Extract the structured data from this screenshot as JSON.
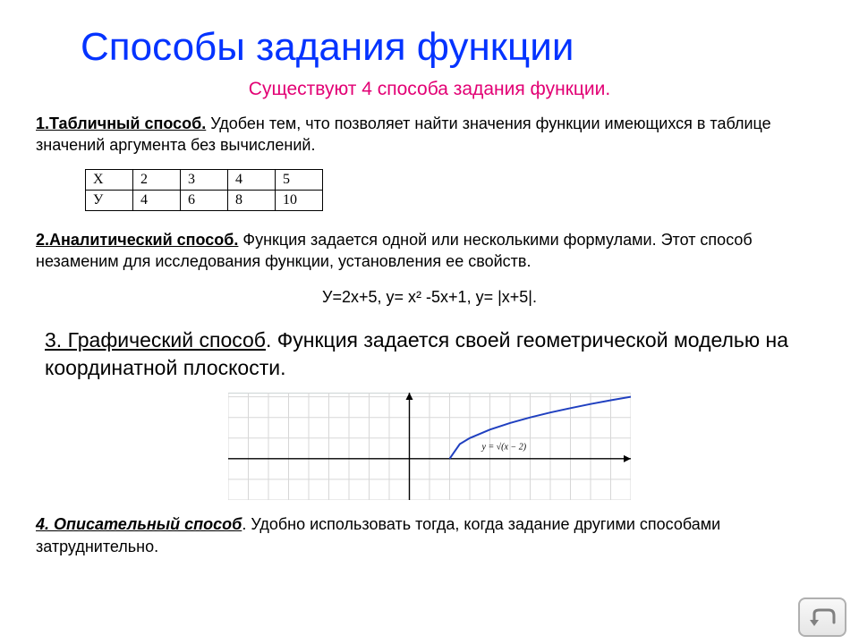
{
  "title": "Способы задания функции",
  "subtitle": "Существуют 4 способа задания функции.",
  "sections": {
    "s1": {
      "heading": "1.Табличный способ.",
      "text": " Удобен тем, что позволяет найти значения функции имеющихся в таблице значений аргумента без вычислений.",
      "table": {
        "row1": [
          "Х",
          "2",
          "3",
          "4",
          "5"
        ],
        "row2": [
          "У",
          "4",
          "6",
          "8",
          "10"
        ]
      }
    },
    "s2": {
      "heading": "2.Аналитический способ.",
      "text": " Функция задается одной или несколькими формулами. Этот способ незаменим для исследования функции, установления ее свойств.",
      "formulas": "У=2х+5,   у= х² -5х+1,    у= |х+5|."
    },
    "s3": {
      "heading": "3. Графический способ",
      "text": ". Функция задается своей геометрической моделью на координатной плоскости."
    },
    "s4": {
      "heading": " 4. Описательный способ",
      "text": ". Удобно использовать тогда, когда задание другими способами затруднительно."
    }
  },
  "chart_data": {
    "type": "line",
    "title": "",
    "function_label": "y = √(x − 2)",
    "xlabel": "",
    "ylabel": "",
    "xlim": [
      -9,
      11
    ],
    "ylim": [
      -2,
      3.2
    ],
    "grid": true,
    "series": [
      {
        "name": "y = √(x − 2)",
        "x": [
          2,
          2.5,
          3,
          4,
          5,
          6,
          7,
          8,
          9,
          10,
          11
        ],
        "y": [
          0,
          0.71,
          1,
          1.41,
          1.73,
          2,
          2.24,
          2.45,
          2.65,
          2.83,
          3
        ]
      }
    ]
  },
  "nav": {
    "return_label": "return"
  }
}
